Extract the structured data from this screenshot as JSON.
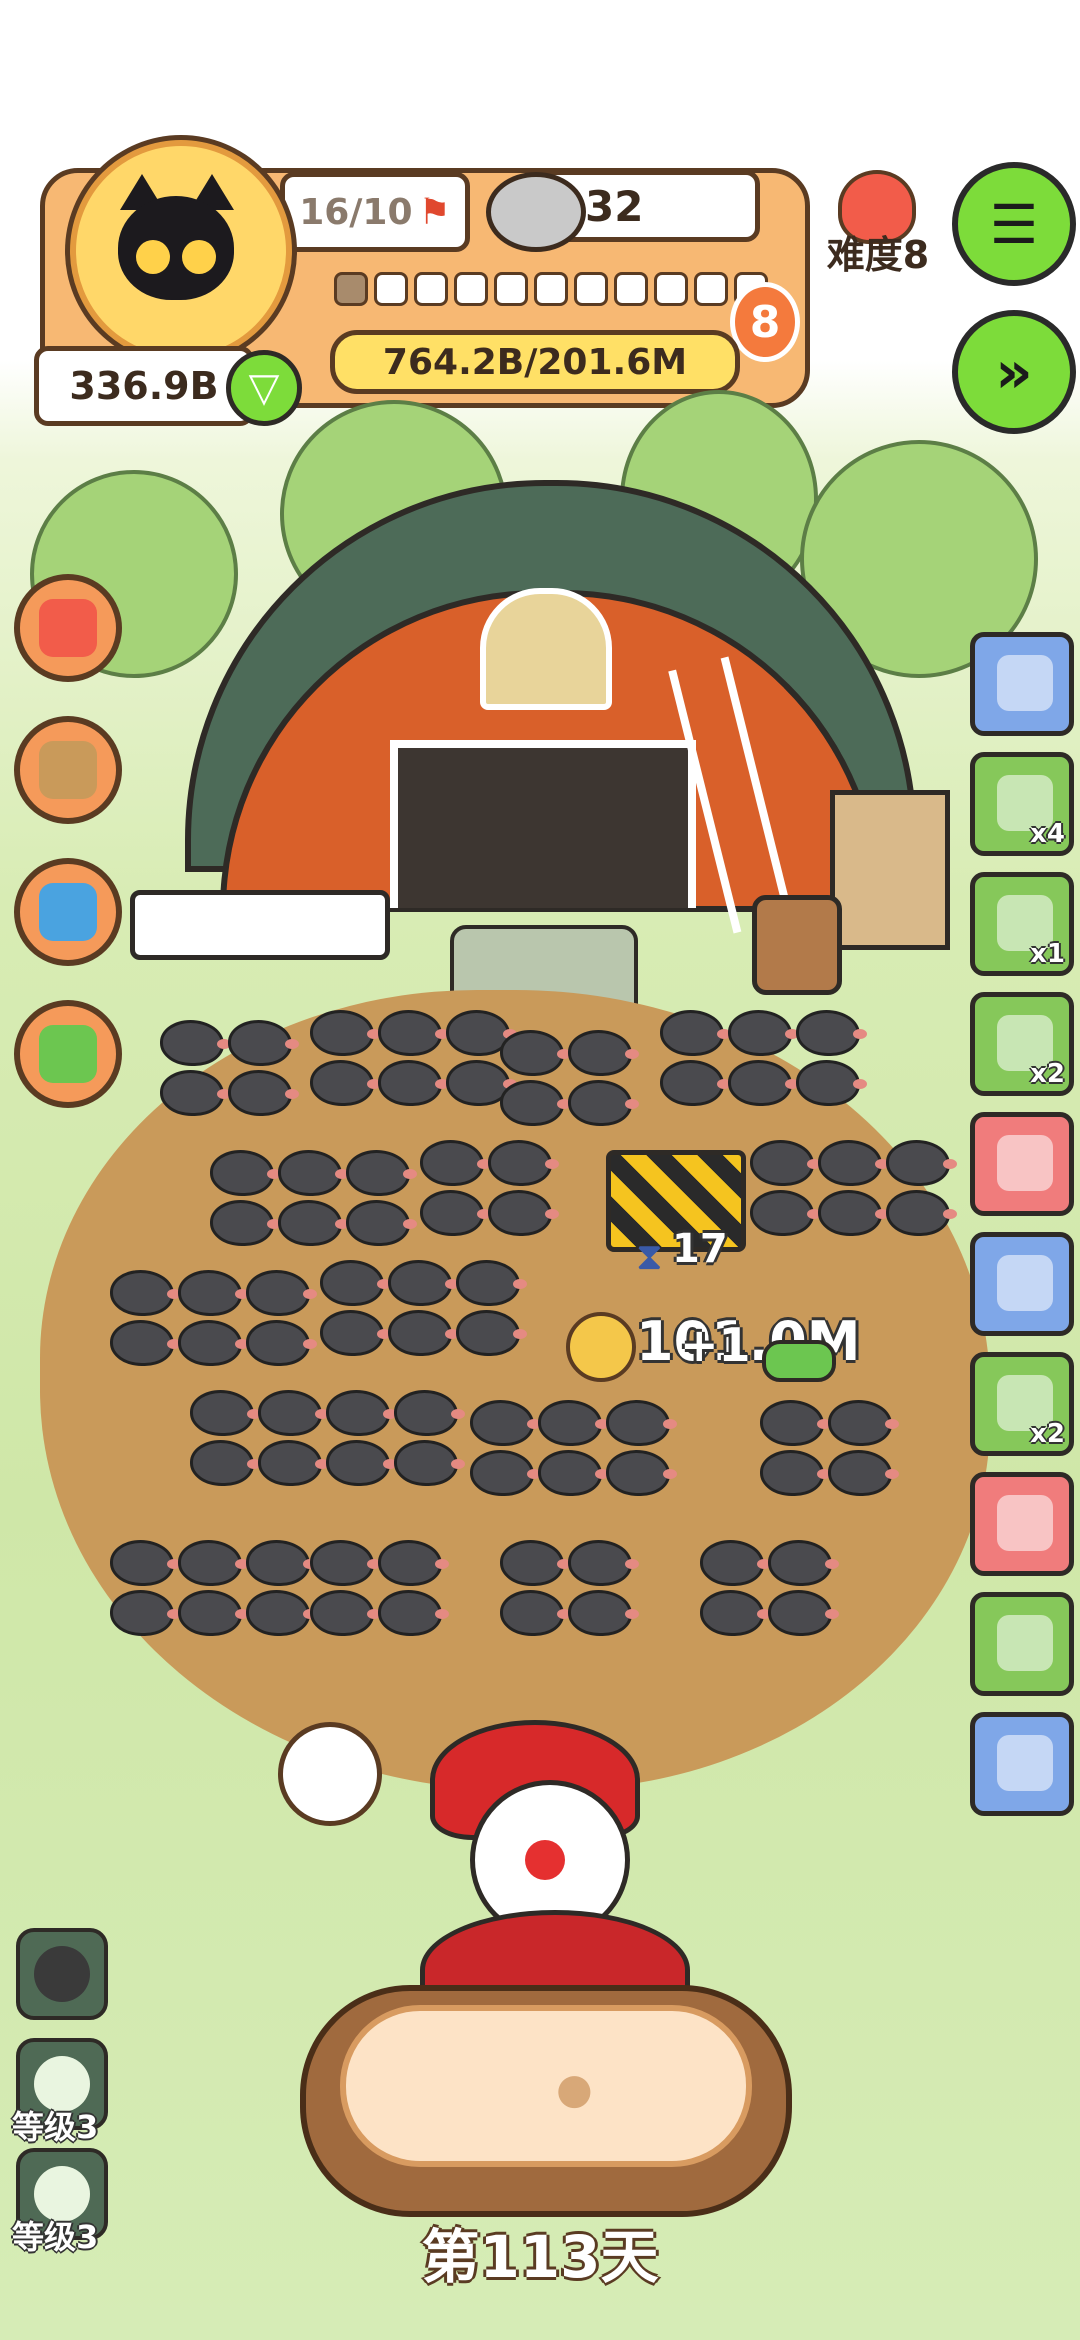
{
  "hud": {
    "level_count": "16/10",
    "coins": "32",
    "difficulty": "难度8",
    "avatar_balance": "336.9B",
    "level_number": "8",
    "resource_progress": "764.2B/201.6M",
    "progress_cells_filled": 1,
    "progress_cells_total": 11
  },
  "scene": {
    "barricade_timer": "17",
    "floating_value": "101.0M",
    "floating_plus": "+1"
  },
  "side_items": [
    {
      "name": "wings-card",
      "badge": "",
      "color": "#7fa7e8"
    },
    {
      "name": "potion-bottle-card",
      "badge": "x4",
      "color": "#86c85a"
    },
    {
      "name": "brush-card",
      "badge": "x1",
      "color": "#86c85a"
    },
    {
      "name": "lollipop-card",
      "badge": "x2",
      "color": "#86c85a"
    },
    {
      "name": "cloud-creature-card",
      "badge": "",
      "color": "#f07c7c"
    },
    {
      "name": "device-card",
      "badge": "",
      "color": "#7fa7e8"
    },
    {
      "name": "worm-card",
      "badge": "x2",
      "color": "#86c85a"
    },
    {
      "name": "green-blob-card",
      "badge": "",
      "color": "#f07c7c"
    },
    {
      "name": "card-payment-card",
      "badge": "",
      "color": "#86c85a"
    },
    {
      "name": "robot-mouse-card",
      "badge": "",
      "color": "#7fa7e8"
    }
  ],
  "left_buttons": [
    {
      "name": "character-button"
    },
    {
      "name": "box-button"
    },
    {
      "name": "bell-button"
    },
    {
      "name": "medkit-button"
    }
  ],
  "skills": [
    {
      "label": ""
    },
    {
      "label": "等级3"
    },
    {
      "label": "等级3"
    }
  ],
  "day": "第113天",
  "colors": {
    "accent_green": "#7ddc3a",
    "panel_orange": "#f7b873",
    "outline": "#5a3b22"
  }
}
